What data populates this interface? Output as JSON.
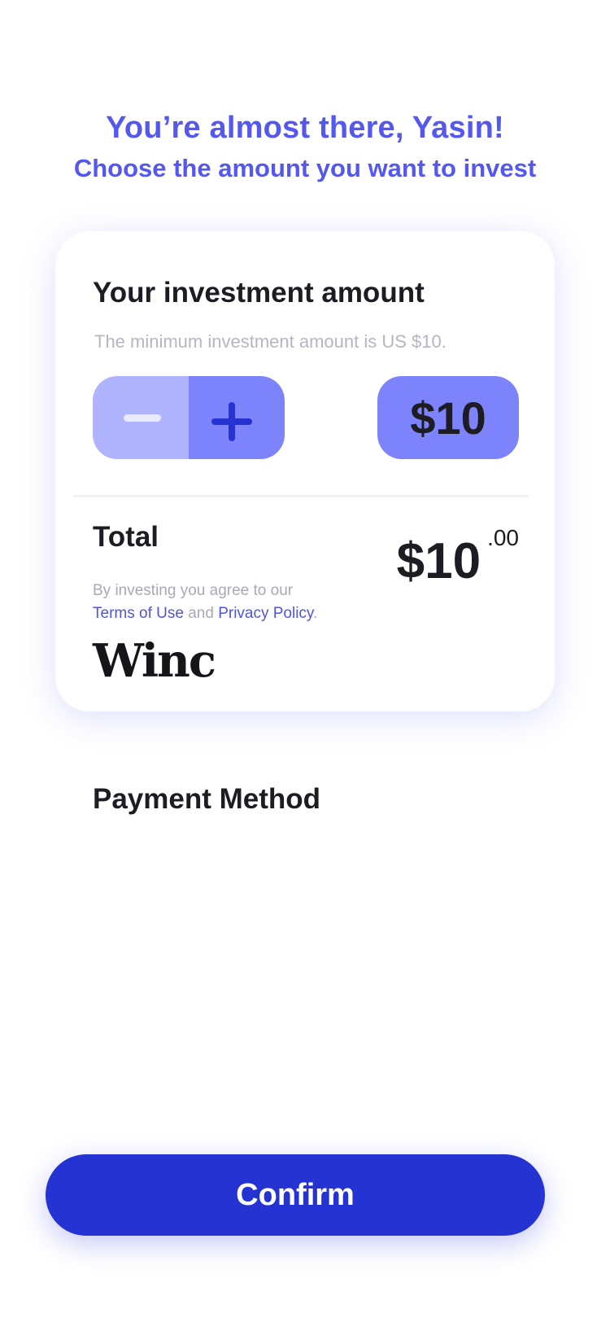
{
  "header": {
    "title": "You’re almost there, Yasin!",
    "subtitle": "Choose the amount you want to invest"
  },
  "investment_card": {
    "title": "Your investment amount",
    "minimum_note": "The minimum investment amount is US $10.",
    "amount": "$10",
    "total_label": "Total",
    "total_main": "$10",
    "total_cents": ".00",
    "agreement_prefix": "By investing you agree to our",
    "terms_link": "Terms of Use",
    "and_text": "and",
    "privacy_link": "Privacy Policy",
    "period": ".",
    "brand_logo": "Winc"
  },
  "payment": {
    "title": "Payment Method"
  },
  "footer": {
    "confirm_label": "Confirm"
  },
  "colors": {
    "accent": "#5558ef",
    "primary_button": "#2433d2",
    "stepper_minus": "#b0b4fd",
    "stepper_plus": "#7d83fb"
  },
  "icons": {
    "decrement": "minus-icon",
    "increment": "plus-icon"
  }
}
